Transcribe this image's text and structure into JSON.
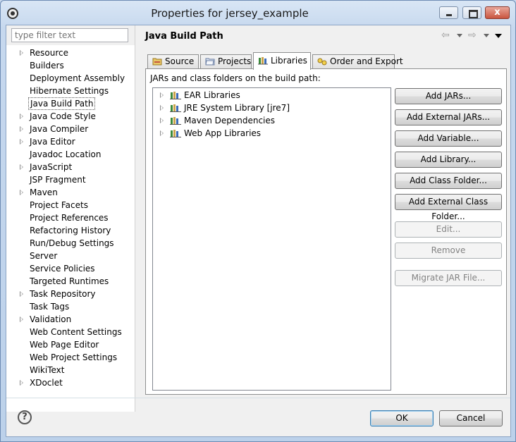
{
  "window": {
    "title": "Properties for jersey_example",
    "close_glyph": "x"
  },
  "filter": {
    "placeholder": "type filter text"
  },
  "nav": {
    "items": [
      {
        "label": "Resource",
        "expandable": true
      },
      {
        "label": "Builders",
        "expandable": false
      },
      {
        "label": "Deployment Assembly",
        "expandable": false
      },
      {
        "label": "Hibernate Settings",
        "expandable": false
      },
      {
        "label": "Java Build Path",
        "expandable": false,
        "selected": true
      },
      {
        "label": "Java Code Style",
        "expandable": true
      },
      {
        "label": "Java Compiler",
        "expandable": true
      },
      {
        "label": "Java Editor",
        "expandable": true
      },
      {
        "label": "Javadoc Location",
        "expandable": false
      },
      {
        "label": "JavaScript",
        "expandable": true
      },
      {
        "label": "JSP Fragment",
        "expandable": false
      },
      {
        "label": "Maven",
        "expandable": true
      },
      {
        "label": "Project Facets",
        "expandable": false
      },
      {
        "label": "Project References",
        "expandable": false
      },
      {
        "label": "Refactoring History",
        "expandable": false
      },
      {
        "label": "Run/Debug Settings",
        "expandable": false
      },
      {
        "label": "Server",
        "expandable": false
      },
      {
        "label": "Service Policies",
        "expandable": false
      },
      {
        "label": "Targeted Runtimes",
        "expandable": false
      },
      {
        "label": "Task Repository",
        "expandable": true
      },
      {
        "label": "Task Tags",
        "expandable": false
      },
      {
        "label": "Validation",
        "expandable": true
      },
      {
        "label": "Web Content Settings",
        "expandable": false
      },
      {
        "label": "Web Page Editor",
        "expandable": false
      },
      {
        "label": "Web Project Settings",
        "expandable": false
      },
      {
        "label": "WikiText",
        "expandable": false
      },
      {
        "label": "XDoclet",
        "expandable": true
      }
    ]
  },
  "page": {
    "title": "Java Build Path",
    "tabs": [
      {
        "label": "Source",
        "icon": "source-folder-icon"
      },
      {
        "label": "Projects",
        "icon": "project-icon"
      },
      {
        "label": "Libraries",
        "icon": "library-icon",
        "active": true
      },
      {
        "label": "Order and Export",
        "icon": "order-export-icon"
      }
    ],
    "caption": "JARs and class folders on the build path:",
    "libraries": [
      {
        "label": "EAR Libraries"
      },
      {
        "label": "JRE System Library [jre7]"
      },
      {
        "label": "Maven Dependencies"
      },
      {
        "label": "Web App Libraries"
      }
    ],
    "buttons": [
      {
        "label": "Add JARs...",
        "enabled": true
      },
      {
        "label": "Add External JARs...",
        "enabled": true
      },
      {
        "label": "Add Variable...",
        "enabled": true
      },
      {
        "label": "Add Library...",
        "enabled": true
      },
      {
        "label": "Add Class Folder...",
        "enabled": true
      },
      {
        "label": "Add External Class Folder...",
        "enabled": true
      },
      {
        "label": "Edit...",
        "enabled": false
      },
      {
        "label": "Remove",
        "enabled": false
      },
      {
        "label": "Migrate JAR File...",
        "enabled": false
      }
    ]
  },
  "footer": {
    "help_glyph": "?",
    "ok_label": "OK",
    "cancel_label": "Cancel"
  },
  "colors": {
    "library_icon_green": "#3b8a3a",
    "library_icon_tan": "#c9a24a"
  }
}
